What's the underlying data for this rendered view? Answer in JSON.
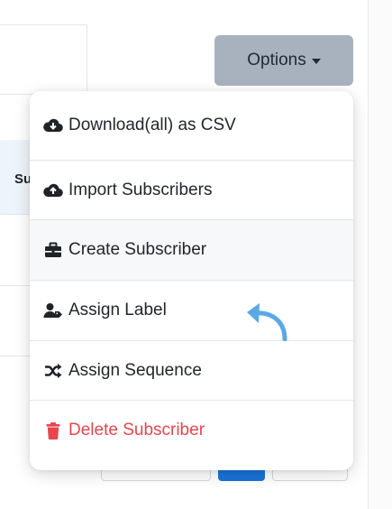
{
  "background": {
    "column_header_partial": "Su"
  },
  "options_button": {
    "label": "Options",
    "caret_icon": "caret-down-icon"
  },
  "dropdown": {
    "items": [
      {
        "label": "Download(all) as CSV",
        "icon": "cloud-download-icon"
      },
      {
        "label": "Import Subscribers",
        "icon": "cloud-upload-icon"
      },
      {
        "label": "Create Subscriber",
        "icon": "briefcase-icon"
      },
      {
        "label": "Assign Label",
        "icon": "user-tag-icon"
      },
      {
        "label": "Assign Sequence",
        "icon": "shuffle-icon"
      },
      {
        "label": "Delete Subscriber",
        "icon": "trash-icon",
        "color": "#e8454d"
      }
    ]
  },
  "colors": {
    "options_button_bg": "#a8b2be",
    "danger": "#e8454d",
    "pointer_arrow": "#5aa8e6",
    "pager_active": "#1a73d9"
  },
  "pointer_icon": "curved-back-arrow-icon"
}
